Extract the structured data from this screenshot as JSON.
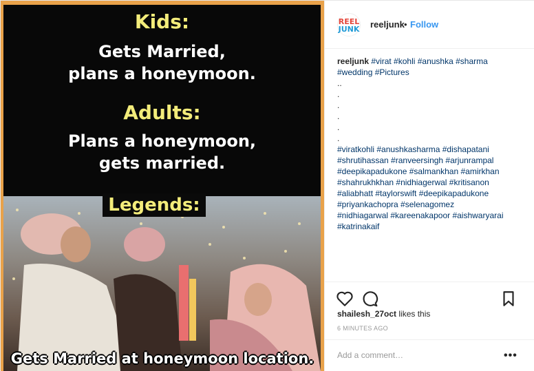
{
  "post": {
    "meme": {
      "kids_heading": "Kids:",
      "kids_line1": "Gets Married,",
      "kids_line2": "plans a honeymoon.",
      "adults_heading": "Adults:",
      "adults_line1": "Plans a honeymoon,",
      "adults_line2": "gets married.",
      "legends_heading": "Legends:",
      "bottom_caption": "Gets Married at honeymoon location."
    }
  },
  "header": {
    "avatar_line1": "REEL",
    "avatar_line2": "JUNK",
    "username": "reeljunk",
    "separator": "•",
    "follow_label": "Follow"
  },
  "caption": {
    "username": "reeljunk",
    "line1_tags": "#virat #kohli #anushka #sharma",
    "line2_tags": "#wedding #Pictures",
    "dot_lines": [
      "..",
      ".",
      ".",
      ".",
      ".",
      "."
    ],
    "tag_lines": [
      "#viratkohli #anushkasharma #dishapatani",
      "#shrutihassan #ranveersingh #arjunrampal",
      "#deepikapadukone #salmankhan #amirkhan",
      "#shahrukhkhan #nidhiagerwal #kritisanon",
      "#aliabhatt #taylorswift #deepikapadukone",
      "#priyankachopra #selenagomez",
      "#nidhiagarwal #kareenakapoor #aishwaryarai",
      "#katrinakaif"
    ]
  },
  "actions": {
    "icons": [
      "heart-icon",
      "comment-icon",
      "bookmark-icon"
    ]
  },
  "likes": {
    "user": "shailesh_27oct",
    "suffix": " likes this"
  },
  "timestamp": "6 MINUTES AGO",
  "comment": {
    "placeholder": "Add a comment…",
    "more": "•••"
  },
  "colors": {
    "follow": "#3897f0",
    "tag": "#003569",
    "meme_yellow": "#f3ec7a"
  }
}
